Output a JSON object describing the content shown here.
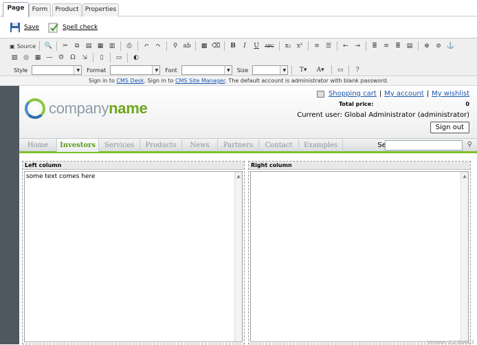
{
  "tabs": [
    "Page",
    "Form",
    "Product",
    "Properties"
  ],
  "actions": {
    "save": "Save",
    "spell": "Spell check"
  },
  "toolbar": {
    "source": "Source",
    "style_label": "Style",
    "format_label": "Format",
    "font_label": "Font",
    "size_label": "Size",
    "bold": "B",
    "italic": "I",
    "underline": "U",
    "strike": "ABC"
  },
  "signin": {
    "pre": "Sign in to ",
    "desk": "CMS Desk",
    "mid": ". Sign in to ",
    "manager": "CMS Site Manager",
    "post": ". The default account is administrator with blank password."
  },
  "site": {
    "logo_light": "company",
    "logo_bold": "name",
    "links": [
      "Shopping cart",
      "My account",
      "My wishlist"
    ],
    "total_label": "Total price:",
    "total_value": "0",
    "current_user": "Current user:  Global Administrator (administrator)",
    "sign_out": "Sign out",
    "nav": [
      "Home",
      "Investors",
      "Services",
      "Products",
      "News",
      "Partners",
      "Contact",
      "Examples"
    ],
    "search_label": "Search:"
  },
  "columns": {
    "left_title": "Left column",
    "left_text": "some text comes here",
    "right_title": "Right column"
  },
  "version": "Version: 3.2 Build:3"
}
